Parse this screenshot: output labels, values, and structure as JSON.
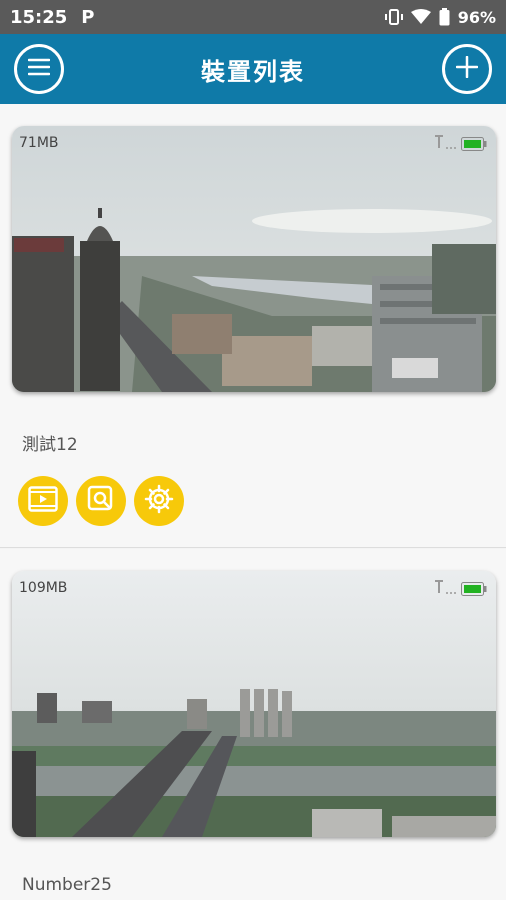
{
  "status_bar": {
    "time": "15:25",
    "carrier_icon": "P",
    "battery_percent": "96%",
    "icons": [
      "vibrate-icon",
      "wifi-icon",
      "battery-icon"
    ]
  },
  "app_bar": {
    "title": "裝置列表",
    "left_icon": "menu-icon",
    "right_icon": "add-icon"
  },
  "devices": [
    {
      "storage": "71MB",
      "name": "測試12",
      "signal_icon": "signal-icon",
      "battery_icon": "battery-full-icon",
      "actions": [
        "video-icon",
        "playback-icon",
        "settings-icon"
      ]
    },
    {
      "storage": "109MB",
      "name": "Number25",
      "signal_icon": "signal-icon",
      "battery_icon": "battery-full-icon"
    }
  ],
  "colors": {
    "app_bar": "#0f7aa8",
    "status_bar": "#5a5a5a",
    "action_button": "#f7c90a",
    "battery_fill": "#22b222"
  }
}
